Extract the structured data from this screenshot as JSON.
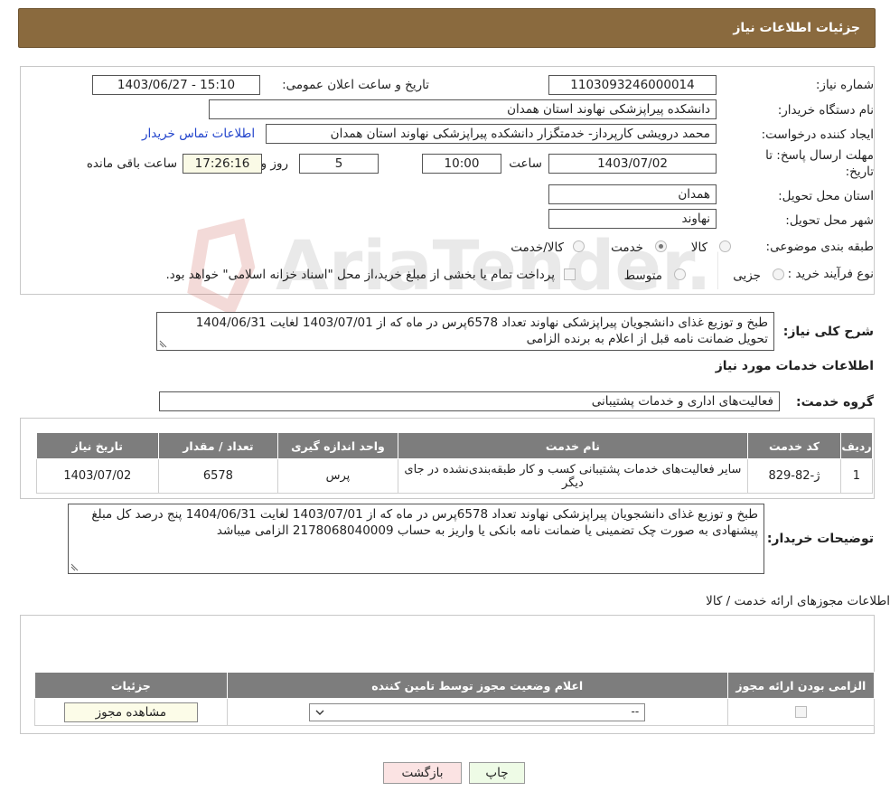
{
  "header": {
    "title": "جزئیات اطلاعات نیاز"
  },
  "form": {
    "need_number_label": "شماره نیاز:",
    "need_number": "1103093246000014",
    "announce_label": "تاریخ و ساعت اعلان عمومی:",
    "announce_value": "1403/06/27 - 15:10",
    "buyer_org_label": "نام دستگاه خریدار:",
    "buyer_org": "دانشکده پیراپزشکی نهاوند  استان همدان",
    "creator_label": "ایجاد کننده درخواست:",
    "creator": "محمد درویشی کارپرداز- خدمتگزار دانشکده پیراپزشکی نهاوند  استان همدان",
    "contact_link": "اطلاعات تماس خریدار",
    "deadline_label_1": "مهلت ارسال پاسخ: تا",
    "deadline_label_2": "تاریخ:",
    "deadline_date": "1403/07/02",
    "hour_label": "ساعت",
    "deadline_time": "10:00",
    "days_value": "5",
    "days_label": "روز و",
    "remaining_time": "17:26:16",
    "remaining_label": "ساعت باقی مانده",
    "province_label": "استان محل تحویل:",
    "province": "همدان",
    "city_label": "شهر محل تحویل:",
    "city": "نهاوند",
    "category_label": "طبقه بندی موضوعی:",
    "category_options": [
      "کالا",
      "خدمت",
      "کالا/خدمت"
    ],
    "category_selected": "خدمت",
    "process_label": "نوع فرآیند خرید :",
    "process_options": [
      "جزیی",
      "متوسط"
    ],
    "process_note": "پرداخت تمام یا بخشی از مبلغ خرید،از محل \"اسناد خزانه اسلامی\" خواهد بود.",
    "summary_label": "شرح کلی نیاز:",
    "summary": "طبخ و توزیع غذای دانشجویان پیراپزشکی نهاوند تعداد 6578پرس در ماه که از 1403/07/01 لغایت 1404/06/31 تحویل ضمانت نامه قبل از اعلام به برنده الزامی"
  },
  "services": {
    "section_title": "اطلاعات خدمات مورد نیاز",
    "group_label": "گروه خدمت:",
    "group_value": "فعالیت‌های اداری و خدمات پشتیبانی",
    "columns": [
      "ردیف",
      "کد خدمت",
      "نام خدمت",
      "واحد اندازه گیری",
      "تعداد / مقدار",
      "تاریخ نیاز"
    ],
    "rows": [
      {
        "index": "1",
        "code": "ژ-82-829",
        "name": "سایر فعالیت‌های خدمات پشتیبانی کسب و کار طبقه‌بندی‌نشده در جای دیگر",
        "unit": "پرس",
        "qty": "6578",
        "date": "1403/07/02"
      }
    ],
    "buyer_notes_label": "توضیحات خریدار:",
    "buyer_notes": "طبخ و توزیع غذای دانشجویان پیراپزشکی نهاوند تعداد 6578پرس در ماه که از 1403/07/01 لغایت 1404/06/31 پنج درصد کل مبلغ پیشنهادی به صورت چک تضمینی یا ضمانت نامه بانکی یا واریز به حساب 2178068040009 الزامی میباشد"
  },
  "permits": {
    "section_title": "اطلاعات مجوزهای ارائه خدمت / کالا",
    "columns": [
      "الزامی بودن ارائه مجوز",
      "اعلام وضعیت مجوز توسط تامین کننده",
      "جزئیات"
    ],
    "select_value": "--",
    "view_button": "مشاهده مجوز"
  },
  "actions": {
    "print": "چاپ",
    "back": "بازگشت"
  },
  "watermark": "AriaTender.neT",
  "colors": {
    "header": "#8a6a3e",
    "table_header": "#7d7d7d",
    "link": "#2244cc",
    "back_button": "#fbe3e3",
    "print_button": "#eefbe6"
  }
}
